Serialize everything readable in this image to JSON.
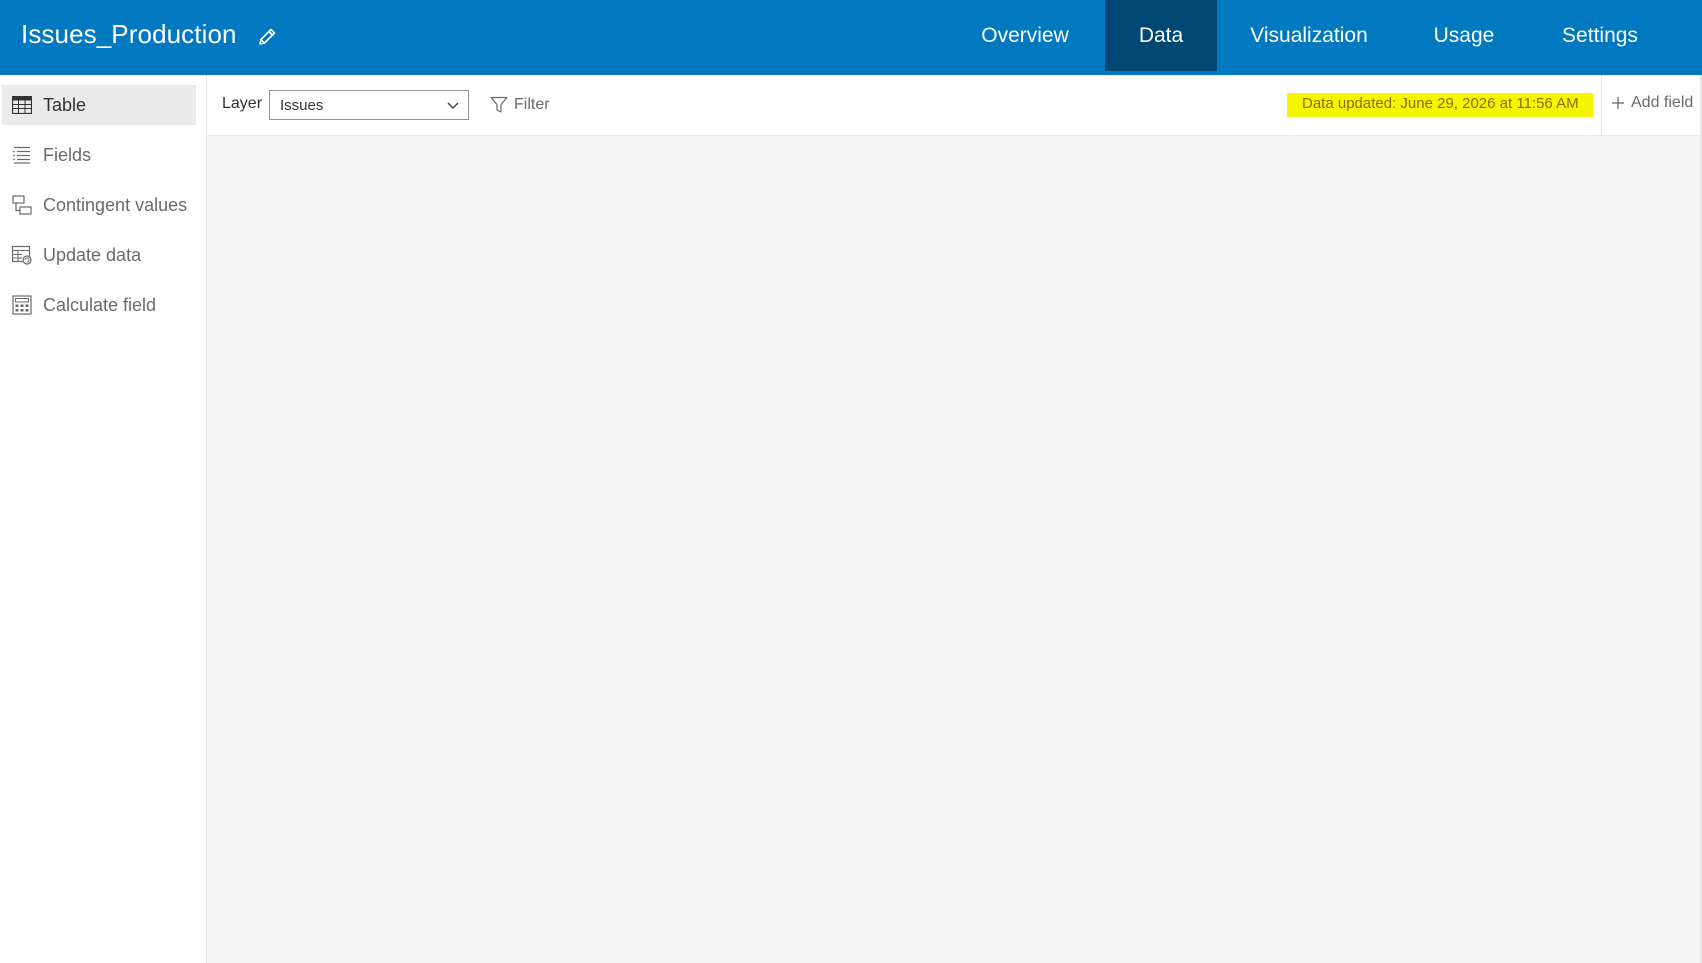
{
  "header": {
    "title": "Issues_Production",
    "edit_icon": "pencil-icon",
    "tabs": [
      {
        "label": "Overview",
        "active": false
      },
      {
        "label": "Data",
        "active": true
      },
      {
        "label": "Visualization",
        "active": false
      },
      {
        "label": "Usage",
        "active": false
      },
      {
        "label": "Settings",
        "active": false
      }
    ]
  },
  "sidebar": {
    "items": [
      {
        "label": "Table",
        "icon": "table-icon",
        "active": true
      },
      {
        "label": "Fields",
        "icon": "fields-list-icon",
        "active": false
      },
      {
        "label": "Contingent values",
        "icon": "contingent-values-icon",
        "active": false
      },
      {
        "label": "Update data",
        "icon": "update-data-icon",
        "active": false
      },
      {
        "label": "Calculate field",
        "icon": "calculator-icon",
        "active": false
      }
    ]
  },
  "toolbar": {
    "layer_label": "Layer",
    "layer_value": "Issues",
    "filter_label": "Filter",
    "data_updated": "Data updated: June 29, 2026 at 11:56 AM",
    "add_field_label": "Add field"
  },
  "colors": {
    "header_bg": "#0079c1",
    "active_tab_bg": "#004874",
    "highlight": "#f5f500"
  }
}
